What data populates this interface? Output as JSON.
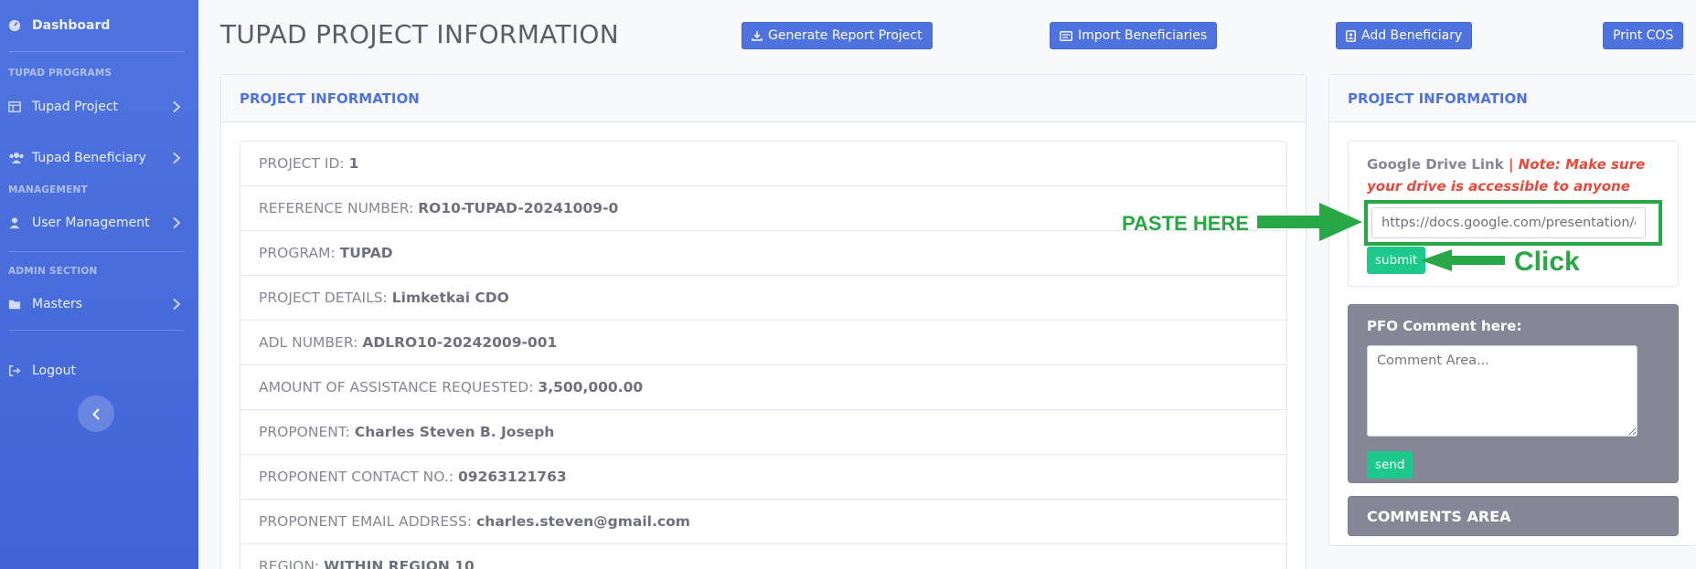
{
  "sidebar": {
    "dashboard": "Dashboard",
    "section_programs": "TUPAD PROGRAMS",
    "tupad_project": "Tupad Project",
    "tupad_beneficiary": "Tupad Beneficiary",
    "section_management": "MANAGEMENT",
    "user_management": "User Management",
    "section_admin": "ADMIN SECTION",
    "masters": "Masters",
    "logout": "Logout"
  },
  "header": {
    "title": "TUPAD PROJECT INFORMATION",
    "btn_generate": "Generate Report Project",
    "btn_import": "Import Beneficiaries",
    "btn_add": "Add Beneficiary",
    "btn_print": "Print COS"
  },
  "info_card": {
    "title": "PROJECT INFORMATION",
    "rows": [
      {
        "label": "PROJECT ID:",
        "value": "1"
      },
      {
        "label": "REFERENCE NUMBER:",
        "value": "RO10-TUPAD-20241009-0"
      },
      {
        "label": "PROGRAM:",
        "value": "TUPAD"
      },
      {
        "label": "PROJECT DETAILS:",
        "value": "Limketkai CDO"
      },
      {
        "label": "ADL NUMBER:",
        "value": "ADLRO10-20242009-001"
      },
      {
        "label": "AMOUNT OF ASSISTANCE REQUESTED:",
        "value": "3,500,000.00"
      },
      {
        "label": "PROPONENT:",
        "value": "Charles Steven B. Joseph"
      },
      {
        "label": "PROPONENT CONTACT NO.:",
        "value": "09263121763"
      },
      {
        "label": "PROPONENT EMAIL ADDRESS:",
        "value": "charles.steven@gmail.com"
      },
      {
        "label": "REGION:",
        "value": "WITHIN REGION 10"
      }
    ]
  },
  "side_card": {
    "title": "PROJECT INFORMATION",
    "drive_label": "Google Drive Link",
    "drive_note": "| Note: Make sure your drive is accessible to anyone",
    "drive_value": "https://docs.google.com/presentation/d",
    "submit": "submit",
    "pfo_title": "PFO Comment here:",
    "pfo_placeholder": "Comment Area...",
    "send": "send",
    "comments_area": "COMMENTS AREA"
  },
  "annotations": {
    "paste_here": "PASTE HERE",
    "click": "Click",
    "color": "#28a745"
  },
  "colors": {
    "primary": "#4e73df",
    "success": "#1cc88a",
    "danger": "#e74a3b",
    "secondary": "#858796"
  }
}
